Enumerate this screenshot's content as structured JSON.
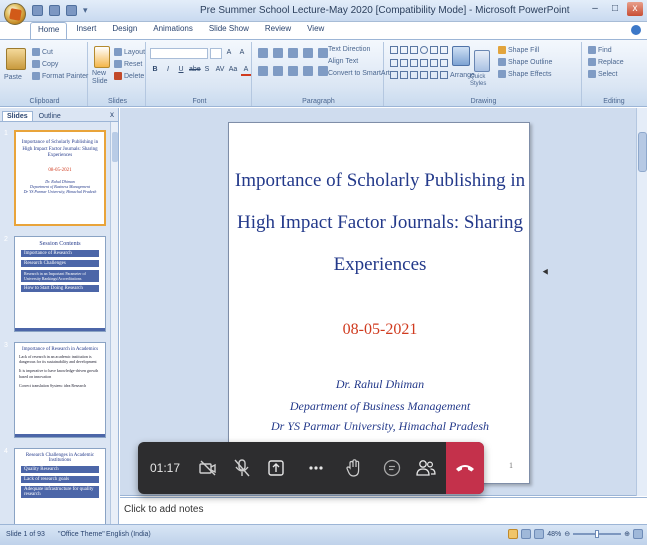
{
  "window": {
    "title": "Pre Summer School Lecture-May 2020 [Compatibility Mode] - Microsoft PowerPoint",
    "controls": [
      "–",
      "□",
      "x"
    ]
  },
  "ribbon_tabs": [
    "Home",
    "Insert",
    "Design",
    "Animations",
    "Slide Show",
    "Review",
    "View"
  ],
  "ribbon": {
    "clipboard": {
      "paste": "Paste",
      "cut": "Cut",
      "copy": "Copy",
      "format_painter": "Format Painter",
      "label": "Clipboard"
    },
    "slides": {
      "new_slide": "New Slide",
      "layout": "Layout",
      "reset": "Reset",
      "delete": "Delete",
      "label": "Slides"
    },
    "font": {
      "bold": "B",
      "italic": "I",
      "underline": "U",
      "strike": "abe",
      "shadow": "S",
      "spacing": "AV",
      "case": "Aa",
      "color": "A",
      "grow": "A",
      "shrink": "A",
      "label": "Font"
    },
    "paragraph": {
      "text_direction": "Text Direction",
      "align_text": "Align Text",
      "smartart": "Convert to SmartArt",
      "label": "Paragraph"
    },
    "drawing": {
      "arrange": "Arrange",
      "quick_styles": "Quick Styles",
      "shape_fill": "Shape Fill",
      "shape_outline": "Shape Outline",
      "shape_effects": "Shape Effects",
      "label": "Drawing"
    },
    "editing": {
      "find": "Find",
      "replace": "Replace",
      "select": "Select",
      "label": "Editing"
    }
  },
  "pane": {
    "tabs": [
      "Slides",
      "Outline"
    ],
    "close": "x",
    "thumbnails": [
      {
        "num": "1",
        "title": "Importance of Scholarly Publishing in High Impact Factor Journals: Sharing Experiences",
        "date": "08-05-2021",
        "lines": [
          "Dr. Rahul Dhiman",
          "Department of Business Management",
          "Dr YS Parmar University, Himachal Pradesh"
        ]
      },
      {
        "num": "2",
        "heading": "Session Contents",
        "boxes": [
          "Importance of Research",
          "Research Challenges",
          "Research in an Important Parameter of University Rankings/Accreditations",
          "How to Start Doing Research"
        ]
      },
      {
        "num": "3",
        "heading": "Importance of Research in Academics",
        "bullets": [
          "Lack of research in an academic institution is dangerous for its sustainability and development",
          "It is imperative to have knowledge-driven growth based on innovation",
          "Correct translation System: idea Research"
        ]
      },
      {
        "num": "4",
        "heading": "Research Challenges in Academic Institutions",
        "boxes": [
          "Quality Research",
          "Lack of research goals",
          "Adequate infrastructure for quality research"
        ]
      }
    ]
  },
  "slide": {
    "title_lines": [
      "Importance of Scholarly Publishing in",
      "High Impact Factor Journals: Sharing",
      "Experiences"
    ],
    "date": "08-05-2021",
    "author": "Dr. Rahul Dhiman",
    "department": "Department of Business Management",
    "university": "Dr YS Parmar University, Himachal Pradesh",
    "number": "1"
  },
  "notes": {
    "placeholder": "Click to add notes"
  },
  "meeting": {
    "timer": "01:17"
  },
  "status": {
    "slide_info": "Slide 1 of 93",
    "theme": "\"Office Theme\"",
    "language": "English (India)",
    "zoom": "48%"
  },
  "colors": {
    "ribbon_bg": "#dbe6f4",
    "slide_title": "#23398a",
    "slide_date": "#d03b1f",
    "meeting_bar": "#2d2d2f",
    "hangup": "#c4314b"
  }
}
